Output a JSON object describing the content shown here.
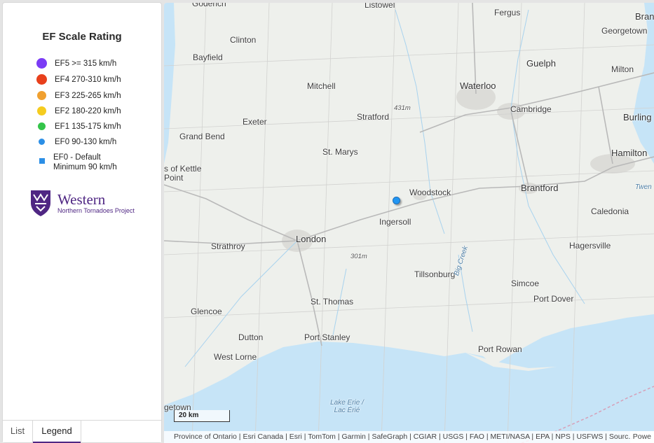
{
  "legend": {
    "title": "EF Scale Rating",
    "items": [
      {
        "label": "EF5  >= 315 km/h",
        "color": "#7b3cf5",
        "shape": "circle-large"
      },
      {
        "label": "EF4  270-310 km/h",
        "color": "#e8401c",
        "shape": "circle-large"
      },
      {
        "label": "EF3  225-265 km/h",
        "color": "#f0a030",
        "shape": "circle-medium"
      },
      {
        "label": "EF2  180-220 km/h",
        "color": "#f5cc1f",
        "shape": "circle-medium"
      },
      {
        "label": "EF1  135-175 km/h",
        "color": "#34c44a",
        "shape": "circle-small"
      },
      {
        "label": "EF0  90-130 km/h",
        "color": "#2c8fe6",
        "shape": "circle-small"
      },
      {
        "label_line1": "EF0 - Default",
        "label_line2": "Minimum 90 km/h",
        "color": "#2c8fe6",
        "shape": "square"
      }
    ]
  },
  "logo": {
    "name": "Western",
    "subtitle": "Northern Tornadoes Project",
    "color": "#4f2683",
    "icon": "western-crest-icon"
  },
  "tabs": [
    {
      "label": "List",
      "active": false
    },
    {
      "label": "Legend",
      "active": true
    }
  ],
  "map": {
    "places": [
      {
        "name": "Goderich"
      },
      {
        "name": "Listowel"
      },
      {
        "name": "Fergus"
      },
      {
        "name": "Bran"
      },
      {
        "name": "Georgetown"
      },
      {
        "name": "Clinton"
      },
      {
        "name": "Bayfield"
      },
      {
        "name": "Guelph"
      },
      {
        "name": "Milton"
      },
      {
        "name": "Mitchell"
      },
      {
        "name": "Waterloo"
      },
      {
        "name": "Cambridge"
      },
      {
        "name": "Burling"
      },
      {
        "name": "Stratford"
      },
      {
        "name": "431m"
      },
      {
        "name": "Exeter"
      },
      {
        "name": "Grand Bend"
      },
      {
        "name": "St. Marys"
      },
      {
        "name": "Hamilton"
      },
      {
        "name": "s of Kettle"
      },
      {
        "name": "Point"
      },
      {
        "name": "Woodstock"
      },
      {
        "name": "Brantford"
      },
      {
        "name": "Ingersoll"
      },
      {
        "name": "Caledonia"
      },
      {
        "name": "London"
      },
      {
        "name": "Strathroy"
      },
      {
        "name": "301m"
      },
      {
        "name": "Hagersville"
      },
      {
        "name": "Tillsonburg"
      },
      {
        "name": "Big Creek"
      },
      {
        "name": "Simcoe"
      },
      {
        "name": "St. Thomas"
      },
      {
        "name": "Glencoe"
      },
      {
        "name": "Port Dover"
      },
      {
        "name": "Dutton"
      },
      {
        "name": "Port Stanley"
      },
      {
        "name": "Port Rowan"
      },
      {
        "name": "West Lorne"
      },
      {
        "name": "Lake Erie /"
      },
      {
        "name": "Lac Érié"
      },
      {
        "name": "getown"
      },
      {
        "name": "Twen"
      }
    ],
    "scale_label": "20 km",
    "attribution": "Province of Ontario | Esri Canada | Esri | TomTom | Garmin | SafeGraph | CGIAR | USGS | FAO | METI/NASA | EPA | NPS | USFWS | Sourc...",
    "powered": "Powe",
    "marker": {
      "rating": "EF0",
      "color": "#2196f3"
    },
    "colors": {
      "land": "#eef0ec",
      "water": "#c6e4f7",
      "urban": "#dcdcd8",
      "road": "#b9b9b9"
    }
  }
}
